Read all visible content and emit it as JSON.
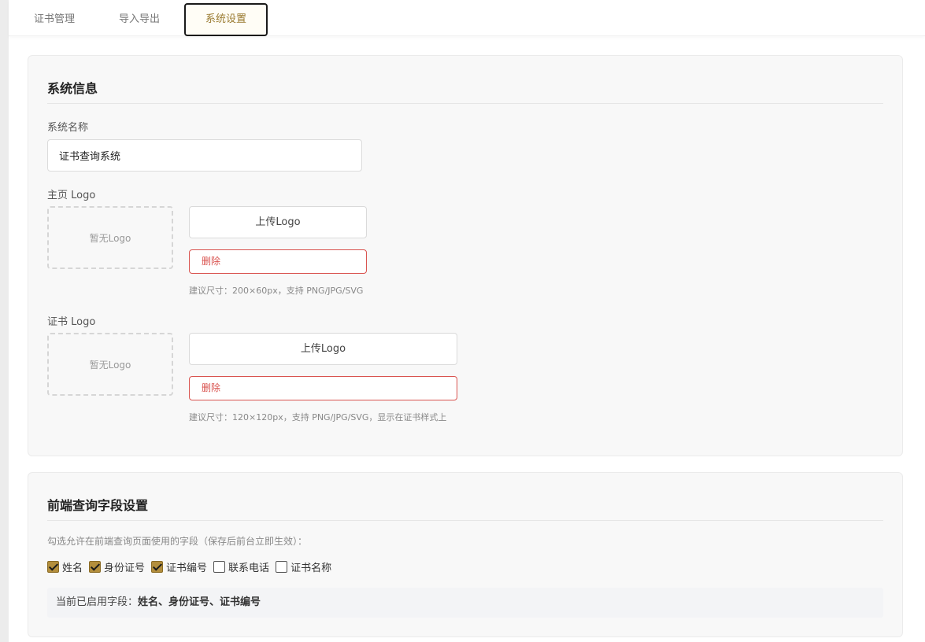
{
  "tabs": [
    {
      "label": "证书管理",
      "active": false
    },
    {
      "label": "导入导出",
      "active": false
    },
    {
      "label": "系统设置",
      "active": true
    }
  ],
  "system_info": {
    "title": "系统信息",
    "name_label": "系统名称",
    "name_value": "证书查询系统",
    "home_logo": {
      "label": "主页 Logo",
      "placeholder": "暂无Logo",
      "upload_label": "上传Logo",
      "delete_label": "删除",
      "hint": "建议尺寸：200×60px，支持 PNG/JPG/SVG"
    },
    "cert_logo": {
      "label": "证书 Logo",
      "placeholder": "暂无Logo",
      "upload_label": "上传Logo",
      "delete_label": "删除",
      "hint": "建议尺寸：120×120px，支持 PNG/JPG/SVG，显示在证书样式上"
    }
  },
  "query_fields": {
    "title": "前端查询字段设置",
    "description": "勾选允许在前端查询页面使用的字段（保存后前台立即生效）：",
    "fields": [
      {
        "label": "姓名",
        "checked": true
      },
      {
        "label": "身份证号",
        "checked": true
      },
      {
        "label": "证书编号",
        "checked": true
      },
      {
        "label": "联系电话",
        "checked": false
      },
      {
        "label": "证书名称",
        "checked": false
      }
    ],
    "summary_prefix": "当前已启用字段：",
    "summary_value": "姓名、身份证号、证书编号"
  },
  "colors": {
    "accent": "#b38e3c",
    "active_tab_text": "#9a7a2f",
    "danger": "#d9534f"
  }
}
